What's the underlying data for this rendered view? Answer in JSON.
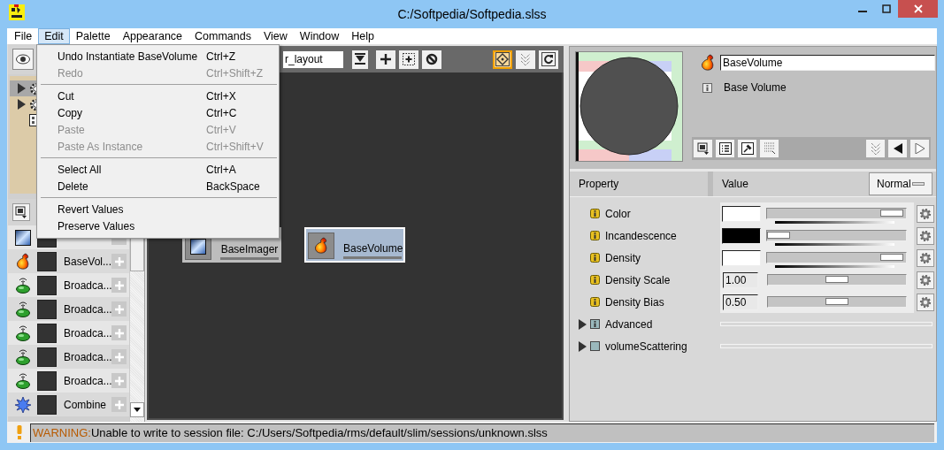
{
  "window": {
    "title": "C:/Softpedia/Softpedia.slss"
  },
  "menubar": [
    {
      "label": "File",
      "selected": false
    },
    {
      "label": "Edit",
      "selected": true
    },
    {
      "label": "Palette",
      "selected": false
    },
    {
      "label": "Appearance",
      "selected": false
    },
    {
      "label": "Commands",
      "selected": false
    },
    {
      "label": "View",
      "selected": false
    },
    {
      "label": "Window",
      "selected": false
    },
    {
      "label": "Help",
      "selected": false
    }
  ],
  "edit_menu": [
    {
      "kind": "item",
      "label": "Undo Instantiate BaseVolume",
      "shortcut": "Ctrl+Z",
      "disabled": false
    },
    {
      "kind": "item",
      "label": "Redo",
      "shortcut": "Ctrl+Shift+Z",
      "disabled": true
    },
    {
      "kind": "separator"
    },
    {
      "kind": "item",
      "label": "Cut",
      "shortcut": "Ctrl+X",
      "disabled": false
    },
    {
      "kind": "item",
      "label": "Copy",
      "shortcut": "Ctrl+C",
      "disabled": false
    },
    {
      "kind": "item",
      "label": "Paste",
      "shortcut": "Ctrl+V",
      "disabled": true
    },
    {
      "kind": "item",
      "label": "Paste As Instance",
      "shortcut": "Ctrl+Shift+V",
      "disabled": true
    },
    {
      "kind": "separator"
    },
    {
      "kind": "item",
      "label": "Select All",
      "shortcut": "Ctrl+A",
      "disabled": false
    },
    {
      "kind": "item",
      "label": "Delete",
      "shortcut": "BackSpace",
      "disabled": false
    },
    {
      "kind": "separator"
    },
    {
      "kind": "item",
      "label": "Revert Values",
      "disabled": false
    },
    {
      "kind": "item",
      "label": "Preserve Values",
      "disabled": false
    }
  ],
  "tree": {
    "items": [
      {
        "kind": "group",
        "expanded": false,
        "selected": true
      },
      {
        "kind": "group",
        "expanded": false,
        "selected": false
      },
      {
        "kind": "leaf",
        "selected": false
      }
    ]
  },
  "palette": {
    "rows": [
      {
        "kind": "imager"
      },
      {
        "kind": "volume",
        "label": "BaseVol..."
      },
      {
        "kind": "broadcast",
        "label": "Broadca..."
      },
      {
        "kind": "broadcast",
        "label": "Broadca..."
      },
      {
        "kind": "broadcast",
        "label": "Broadca..."
      },
      {
        "kind": "broadcast",
        "label": "Broadca..."
      },
      {
        "kind": "broadcast",
        "label": "Broadca..."
      },
      {
        "kind": "combine",
        "label": "Combine"
      }
    ]
  },
  "editor": {
    "layout_field": "r_layout",
    "view_buttons": [
      {
        "selected": true
      },
      {
        "selected": false
      },
      {
        "selected": false
      }
    ],
    "nodes": [
      {
        "label": "BaseImager",
        "kind": "imager",
        "selected": false
      },
      {
        "label": "BaseVolume",
        "kind": "volume",
        "selected": true
      }
    ]
  },
  "inspector": {
    "name": "BaseVolume",
    "description": "Base Volume",
    "columns": [
      "Property",
      "Value"
    ],
    "mode": "Normal",
    "properties": [
      {
        "kind": "color",
        "label": "Color",
        "color": "#ffffff",
        "level": 0.98
      },
      {
        "kind": "color",
        "label": "Incandescence",
        "color": "#000000",
        "level": 0
      },
      {
        "kind": "color",
        "label": "Density",
        "color": "#ffffff",
        "level": 0.98
      },
      {
        "kind": "number",
        "label": "Density Scale",
        "value": "1.00",
        "level": 0.5
      },
      {
        "kind": "number",
        "label": "Density Bias",
        "value": "0.50",
        "level": 0.5
      },
      {
        "kind": "group",
        "label": "Advanced",
        "expanded": false
      },
      {
        "kind": "group",
        "label": "volumeScattering",
        "expanded": false
      }
    ]
  },
  "status_bar": {
    "warning": "WARNING:",
    "message": "Unable to write to session file: C:/Users/Softpedia/rms/default/slim/sessions/unknown.slss"
  }
}
